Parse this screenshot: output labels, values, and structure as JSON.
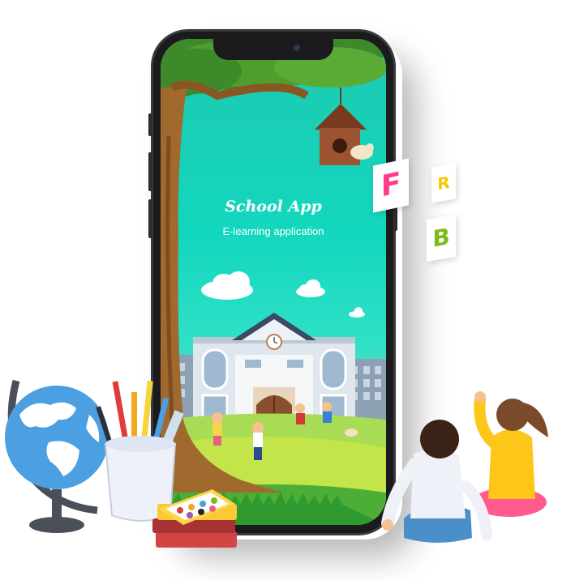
{
  "app": {
    "title": "School App",
    "subtitle": "E-learning application"
  },
  "letters": [
    "F",
    "R",
    "B"
  ],
  "colors": {
    "screen_top": "#1fc8b0",
    "grass": "#9be07a",
    "letter_f": "#ff3c8c",
    "letter_r": "#f7c900",
    "letter_b": "#7dbb1a"
  }
}
